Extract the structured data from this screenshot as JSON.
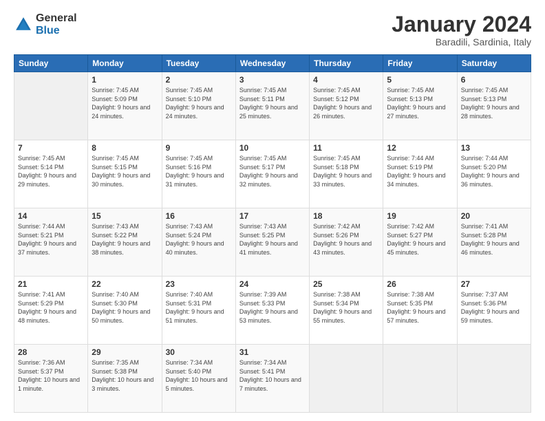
{
  "header": {
    "logo_general": "General",
    "logo_blue": "Blue",
    "month_title": "January 2024",
    "subtitle": "Baradili, Sardinia, Italy"
  },
  "calendar": {
    "headers": [
      "Sunday",
      "Monday",
      "Tuesday",
      "Wednesday",
      "Thursday",
      "Friday",
      "Saturday"
    ],
    "rows": [
      [
        {
          "day": "",
          "sunrise": "",
          "sunset": "",
          "daylight": ""
        },
        {
          "day": "1",
          "sunrise": "Sunrise: 7:45 AM",
          "sunset": "Sunset: 5:09 PM",
          "daylight": "Daylight: 9 hours and 24 minutes."
        },
        {
          "day": "2",
          "sunrise": "Sunrise: 7:45 AM",
          "sunset": "Sunset: 5:10 PM",
          "daylight": "Daylight: 9 hours and 24 minutes."
        },
        {
          "day": "3",
          "sunrise": "Sunrise: 7:45 AM",
          "sunset": "Sunset: 5:11 PM",
          "daylight": "Daylight: 9 hours and 25 minutes."
        },
        {
          "day": "4",
          "sunrise": "Sunrise: 7:45 AM",
          "sunset": "Sunset: 5:12 PM",
          "daylight": "Daylight: 9 hours and 26 minutes."
        },
        {
          "day": "5",
          "sunrise": "Sunrise: 7:45 AM",
          "sunset": "Sunset: 5:13 PM",
          "daylight": "Daylight: 9 hours and 27 minutes."
        },
        {
          "day": "6",
          "sunrise": "Sunrise: 7:45 AM",
          "sunset": "Sunset: 5:13 PM",
          "daylight": "Daylight: 9 hours and 28 minutes."
        }
      ],
      [
        {
          "day": "7",
          "sunrise": "Sunrise: 7:45 AM",
          "sunset": "Sunset: 5:14 PM",
          "daylight": "Daylight: 9 hours and 29 minutes."
        },
        {
          "day": "8",
          "sunrise": "Sunrise: 7:45 AM",
          "sunset": "Sunset: 5:15 PM",
          "daylight": "Daylight: 9 hours and 30 minutes."
        },
        {
          "day": "9",
          "sunrise": "Sunrise: 7:45 AM",
          "sunset": "Sunset: 5:16 PM",
          "daylight": "Daylight: 9 hours and 31 minutes."
        },
        {
          "day": "10",
          "sunrise": "Sunrise: 7:45 AM",
          "sunset": "Sunset: 5:17 PM",
          "daylight": "Daylight: 9 hours and 32 minutes."
        },
        {
          "day": "11",
          "sunrise": "Sunrise: 7:45 AM",
          "sunset": "Sunset: 5:18 PM",
          "daylight": "Daylight: 9 hours and 33 minutes."
        },
        {
          "day": "12",
          "sunrise": "Sunrise: 7:44 AM",
          "sunset": "Sunset: 5:19 PM",
          "daylight": "Daylight: 9 hours and 34 minutes."
        },
        {
          "day": "13",
          "sunrise": "Sunrise: 7:44 AM",
          "sunset": "Sunset: 5:20 PM",
          "daylight": "Daylight: 9 hours and 36 minutes."
        }
      ],
      [
        {
          "day": "14",
          "sunrise": "Sunrise: 7:44 AM",
          "sunset": "Sunset: 5:21 PM",
          "daylight": "Daylight: 9 hours and 37 minutes."
        },
        {
          "day": "15",
          "sunrise": "Sunrise: 7:43 AM",
          "sunset": "Sunset: 5:22 PM",
          "daylight": "Daylight: 9 hours and 38 minutes."
        },
        {
          "day": "16",
          "sunrise": "Sunrise: 7:43 AM",
          "sunset": "Sunset: 5:24 PM",
          "daylight": "Daylight: 9 hours and 40 minutes."
        },
        {
          "day": "17",
          "sunrise": "Sunrise: 7:43 AM",
          "sunset": "Sunset: 5:25 PM",
          "daylight": "Daylight: 9 hours and 41 minutes."
        },
        {
          "day": "18",
          "sunrise": "Sunrise: 7:42 AM",
          "sunset": "Sunset: 5:26 PM",
          "daylight": "Daylight: 9 hours and 43 minutes."
        },
        {
          "day": "19",
          "sunrise": "Sunrise: 7:42 AM",
          "sunset": "Sunset: 5:27 PM",
          "daylight": "Daylight: 9 hours and 45 minutes."
        },
        {
          "day": "20",
          "sunrise": "Sunrise: 7:41 AM",
          "sunset": "Sunset: 5:28 PM",
          "daylight": "Daylight: 9 hours and 46 minutes."
        }
      ],
      [
        {
          "day": "21",
          "sunrise": "Sunrise: 7:41 AM",
          "sunset": "Sunset: 5:29 PM",
          "daylight": "Daylight: 9 hours and 48 minutes."
        },
        {
          "day": "22",
          "sunrise": "Sunrise: 7:40 AM",
          "sunset": "Sunset: 5:30 PM",
          "daylight": "Daylight: 9 hours and 50 minutes."
        },
        {
          "day": "23",
          "sunrise": "Sunrise: 7:40 AM",
          "sunset": "Sunset: 5:31 PM",
          "daylight": "Daylight: 9 hours and 51 minutes."
        },
        {
          "day": "24",
          "sunrise": "Sunrise: 7:39 AM",
          "sunset": "Sunset: 5:33 PM",
          "daylight": "Daylight: 9 hours and 53 minutes."
        },
        {
          "day": "25",
          "sunrise": "Sunrise: 7:38 AM",
          "sunset": "Sunset: 5:34 PM",
          "daylight": "Daylight: 9 hours and 55 minutes."
        },
        {
          "day": "26",
          "sunrise": "Sunrise: 7:38 AM",
          "sunset": "Sunset: 5:35 PM",
          "daylight": "Daylight: 9 hours and 57 minutes."
        },
        {
          "day": "27",
          "sunrise": "Sunrise: 7:37 AM",
          "sunset": "Sunset: 5:36 PM",
          "daylight": "Daylight: 9 hours and 59 minutes."
        }
      ],
      [
        {
          "day": "28",
          "sunrise": "Sunrise: 7:36 AM",
          "sunset": "Sunset: 5:37 PM",
          "daylight": "Daylight: 10 hours and 1 minute."
        },
        {
          "day": "29",
          "sunrise": "Sunrise: 7:35 AM",
          "sunset": "Sunset: 5:38 PM",
          "daylight": "Daylight: 10 hours and 3 minutes."
        },
        {
          "day": "30",
          "sunrise": "Sunrise: 7:34 AM",
          "sunset": "Sunset: 5:40 PM",
          "daylight": "Daylight: 10 hours and 5 minutes."
        },
        {
          "day": "31",
          "sunrise": "Sunrise: 7:34 AM",
          "sunset": "Sunset: 5:41 PM",
          "daylight": "Daylight: 10 hours and 7 minutes."
        },
        {
          "day": "",
          "sunrise": "",
          "sunset": "",
          "daylight": ""
        },
        {
          "day": "",
          "sunrise": "",
          "sunset": "",
          "daylight": ""
        },
        {
          "day": "",
          "sunrise": "",
          "sunset": "",
          "daylight": ""
        }
      ]
    ]
  }
}
